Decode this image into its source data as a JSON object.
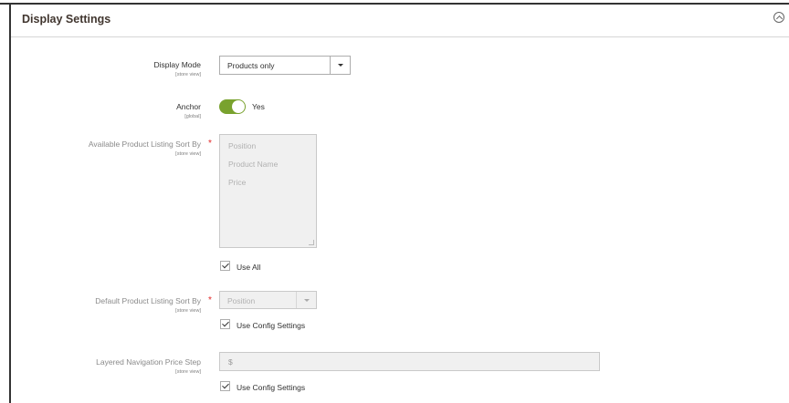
{
  "section": {
    "title": "Display Settings"
  },
  "fields": {
    "display_mode": {
      "label": "Display Mode",
      "scope": "[store view]",
      "value": "Products only"
    },
    "anchor": {
      "label": "Anchor",
      "scope": "[global]",
      "toggle_label": "Yes",
      "checked": true
    },
    "available_sort": {
      "label": "Available Product Listing Sort By",
      "scope": "[store view]",
      "required_marker": "*",
      "options": [
        "Position",
        "Product Name",
        "Price"
      ],
      "use_all_label": "Use All"
    },
    "default_sort": {
      "label": "Default Product Listing Sort By",
      "scope": "[store view]",
      "required_marker": "*",
      "value": "Position",
      "use_config_label": "Use Config Settings"
    },
    "price_step": {
      "label": "Layered Navigation Price Step",
      "scope": "[store view]",
      "prefix": "$",
      "use_config_label": "Use Config Settings"
    }
  },
  "colors": {
    "toggle_on": "#79a22e",
    "required": "#e22626"
  }
}
